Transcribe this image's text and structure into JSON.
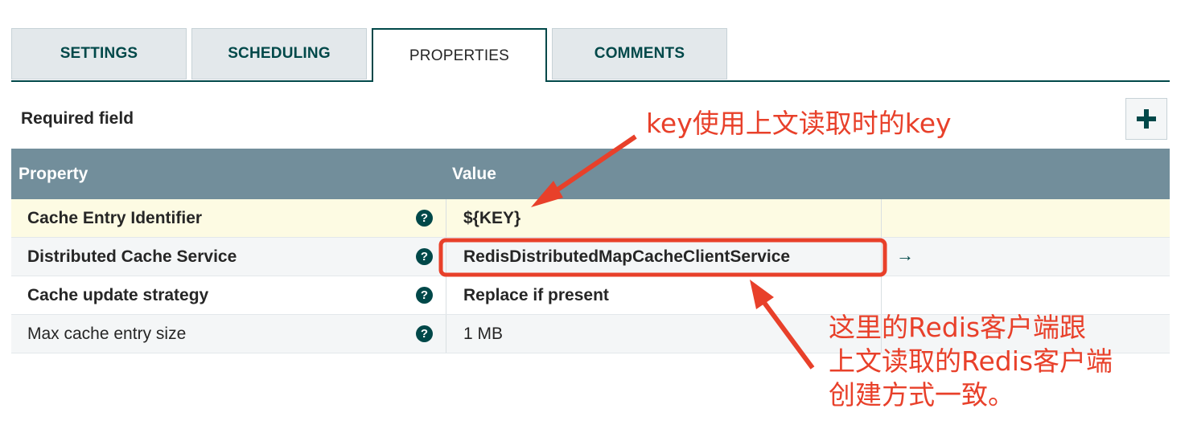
{
  "tabs": [
    {
      "label": "SETTINGS"
    },
    {
      "label": "SCHEDULING"
    },
    {
      "label": "PROPERTIES",
      "active": true
    },
    {
      "label": "COMMENTS"
    }
  ],
  "required_field_label": "Required field",
  "add_button_icon": "plus-icon",
  "table": {
    "headers": {
      "property": "Property",
      "value": "Value"
    },
    "rows": [
      {
        "property": "Cache Entry Identifier",
        "value": "${KEY}",
        "required": true
      },
      {
        "property": "Distributed Cache Service",
        "value": "RedisDistributedMapCacheClientService",
        "required": true,
        "goto_icon": "arrow-right-icon"
      },
      {
        "property": "Cache update strategy",
        "value": "Replace if present",
        "required": true
      },
      {
        "property": "Max cache entry size",
        "value": "1 MB",
        "required": false
      }
    ]
  },
  "help_icon_symbol": "?",
  "goto_symbol": "→",
  "annotations": {
    "key_note": "key使用上文读取时的key",
    "redis_note_lines": [
      "这里的Redis客户端跟",
      "上文读取的Redis客户端",
      "创建方式一致。"
    ],
    "color": "#e8402a"
  },
  "colors": {
    "header_bg": "#728e9b",
    "accent": "#004849",
    "highlight_row": "#fdfbe3"
  }
}
